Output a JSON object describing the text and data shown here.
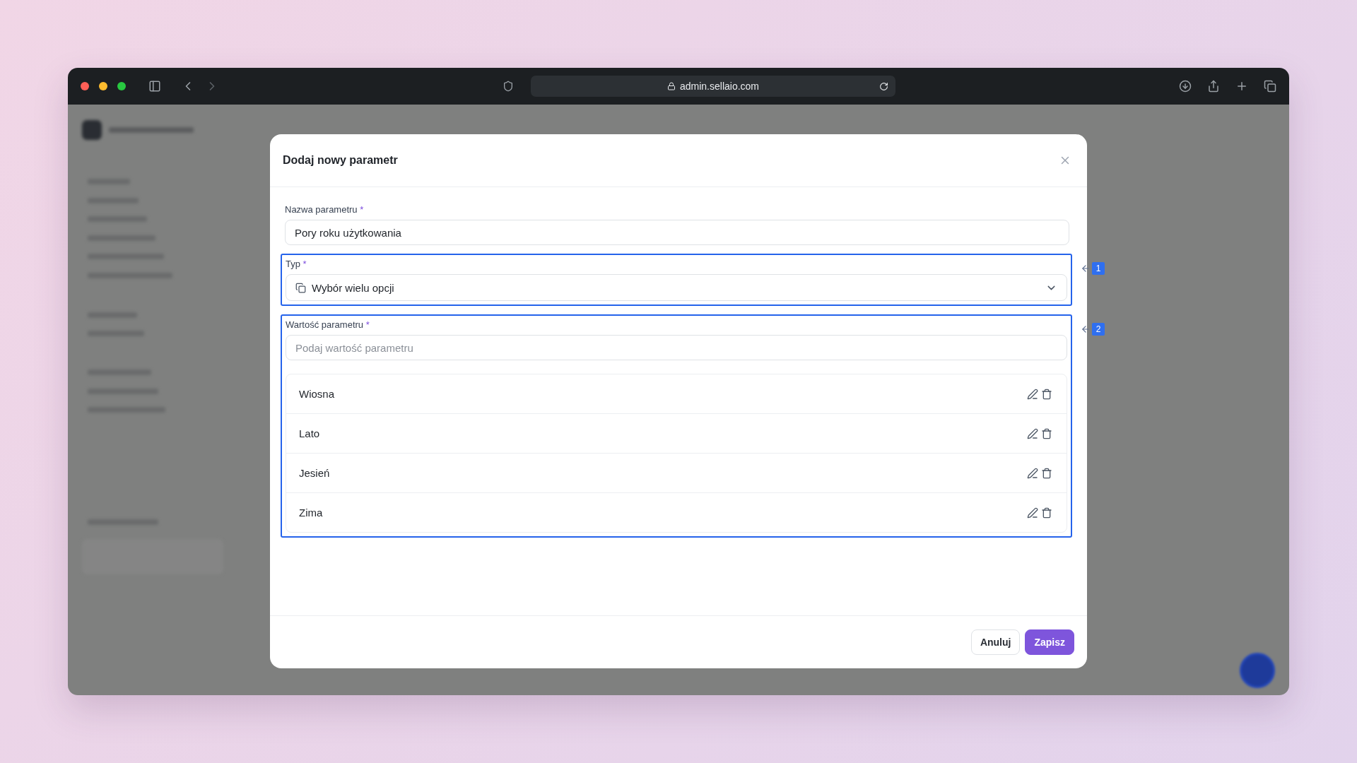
{
  "browser": {
    "address": "admin.sellaio.com"
  },
  "dialog": {
    "title": "Dodaj nowy parametr",
    "name_field": {
      "label": "Nazwa parametru",
      "required_mark": "*",
      "value": "Pory roku użytkowania"
    },
    "type_field": {
      "label": "Typ",
      "required_mark": "*",
      "value": "Wybór wielu opcji"
    },
    "value_field": {
      "label": "Wartość parametru",
      "required_mark": "*",
      "placeholder": "Podaj wartość parametru"
    },
    "values": [
      {
        "label": "Wiosna"
      },
      {
        "label": "Lato"
      },
      {
        "label": "Jesień"
      },
      {
        "label": "Zima"
      }
    ],
    "buttons": [
      {
        "label": "Anuluj",
        "kind": "secondary"
      },
      {
        "label": "Zapisz",
        "kind": "primary"
      }
    ]
  },
  "annotations": [
    {
      "label": "1"
    },
    {
      "label": "2"
    }
  ]
}
